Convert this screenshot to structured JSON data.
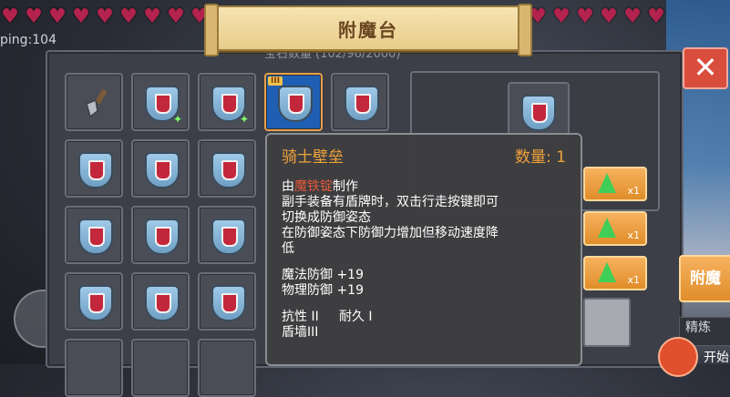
{
  "hud": {
    "ping": "ping:104",
    "hearts_left": [
      "♥",
      "♥",
      "♥",
      "♥",
      "♥",
      "♥",
      "♥",
      "♥",
      "♥"
    ],
    "hearts_right": [
      "♥",
      "♥",
      "♥",
      "♥",
      "♥",
      "♥",
      "♥"
    ]
  },
  "window": {
    "title": "附魔台",
    "sub_title": "宝石数量 (102/96/2000)",
    "close_symbol": "✕"
  },
  "inventory": {
    "selected_badge": "III",
    "slots": [
      {
        "item": "shovel"
      },
      {
        "item": "shield",
        "sparkle": "✦"
      },
      {
        "item": "shield",
        "sparkle": "✦"
      },
      {
        "item": "shield",
        "selected": true
      },
      {
        "item": "shield"
      },
      {
        "item": "shield"
      },
      {
        "item": "shield"
      },
      {
        "item": "shield"
      },
      {
        "item": "shield"
      },
      {
        "item": "shield"
      },
      {
        "item": "shield"
      },
      {
        "item": "shield"
      },
      {
        "item": "shield"
      },
      {
        "item": "shield"
      }
    ]
  },
  "gems": {
    "colors": {
      "gem": "#3fcf58",
      "button": "#e08d2a"
    },
    "buttons": [
      {
        "count": "x1"
      },
      {
        "count": "x1"
      },
      {
        "count": "x1"
      }
    ]
  },
  "side": {
    "enchant_label": "附魔",
    "dark_label": "精炼",
    "start_label": "开始"
  },
  "tooltip": {
    "name": "骑士壁垒",
    "quantity": "数量: 1",
    "made_prefix": "由",
    "made_material": "魔铁锭",
    "made_suffix": "制作",
    "desc": [
      "副手装备有盾牌时，双击行走按键即可",
      "切换成防御姿态",
      "在防御姿态下防御力增加但移动速度降",
      "低"
    ],
    "stats": [
      "魔法防御 +19",
      "物理防御 +19"
    ],
    "enchants_line": "抗性 II     耐久 I",
    "enchant2": "盾墙III"
  }
}
